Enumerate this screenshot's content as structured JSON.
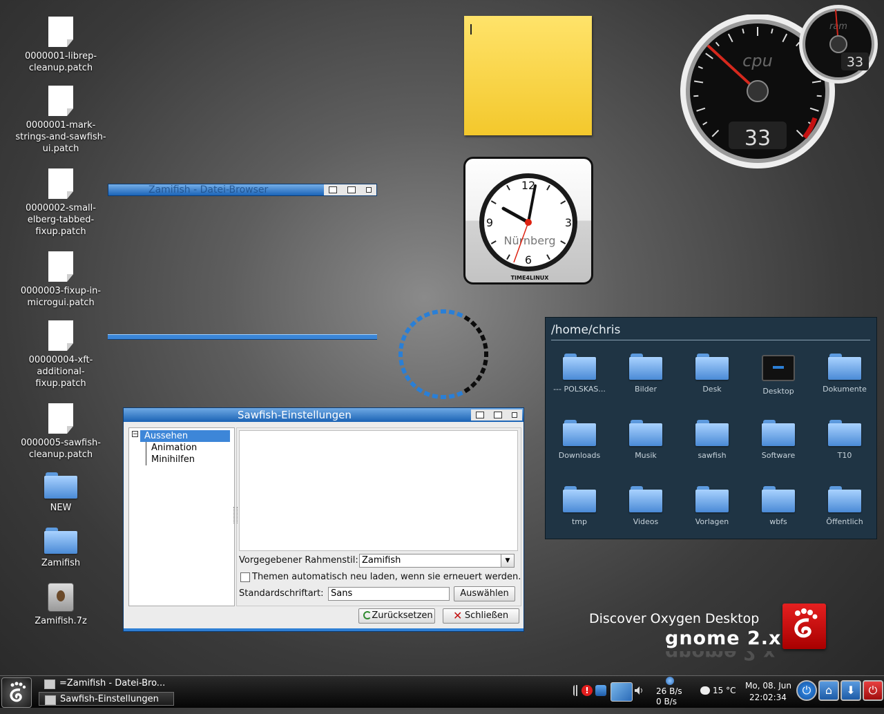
{
  "desktop": {
    "icons": [
      {
        "label": "0000001-librep-cleanup.patch",
        "type": "document"
      },
      {
        "label": "0000001-mark-strings-and-sawfish-ui.patch",
        "type": "document"
      },
      {
        "label": "0000002-small-elberg-tabbed-fixup.patch",
        "type": "document"
      },
      {
        "label": "0000003-fixup-in-microgui.patch",
        "type": "document"
      },
      {
        "label": "00000004-xft-additional-fixup.patch",
        "type": "document"
      },
      {
        "label": "0000005-sawfish-cleanup.patch",
        "type": "document"
      },
      {
        "label": "NEW",
        "type": "folder"
      },
      {
        "label": "Zamifish",
        "type": "folder"
      },
      {
        "label": "Zamifish.7z",
        "type": "archive"
      }
    ]
  },
  "file_browser_window": {
    "title": "Zamifish - Datei-Browser"
  },
  "clock": {
    "city": "Nürnberg",
    "brand": "TIME4LINUX",
    "n12": "12",
    "n3": "3",
    "n6": "6",
    "n9": "9"
  },
  "gauges": {
    "cpu": {
      "label": "cpu",
      "value": "33",
      "level_percent": 33
    },
    "ram": {
      "label": "ram",
      "value": "33",
      "level_percent": 33
    }
  },
  "folder_widget": {
    "path": "/home/chris",
    "items": [
      {
        "label": "--- POLSKAS...",
        "type": "folder"
      },
      {
        "label": "Bilder",
        "type": "folder"
      },
      {
        "label": "Desk",
        "type": "folder"
      },
      {
        "label": "Desktop",
        "type": "screen"
      },
      {
        "label": "Dokumente",
        "type": "folder"
      },
      {
        "label": "Downloads",
        "type": "folder"
      },
      {
        "label": "Musik",
        "type": "folder"
      },
      {
        "label": "sawfish",
        "type": "folder"
      },
      {
        "label": "Software",
        "type": "folder"
      },
      {
        "label": "T10",
        "type": "folder"
      },
      {
        "label": "tmp",
        "type": "folder"
      },
      {
        "label": "Videos",
        "type": "folder"
      },
      {
        "label": "Vorlagen",
        "type": "folder"
      },
      {
        "label": "wbfs",
        "type": "folder"
      },
      {
        "label": "Öffentlich",
        "type": "folder"
      }
    ]
  },
  "branding": {
    "tagline": "Discover Oxygen Desktop",
    "product": "gnome 2.x"
  },
  "settings_window": {
    "title": "Sawfish-Einstellungen",
    "tree": {
      "expander": "−",
      "items": [
        "Aussehen",
        "Animation",
        "Minihilfen"
      ]
    },
    "frame_style_label": "Vorgegebener Rahmenstil:",
    "frame_style_value": "Zamifish",
    "auto_reload_label": "Themen automatisch neu laden, wenn sie erneuert werden.",
    "auto_reload_checked": false,
    "font_label": "Standardschriftart:",
    "font_value": "Sans",
    "choose_button": "Auswählen ...",
    "reset_button": "Zurücksetzen",
    "close_button": "Schließen"
  },
  "taskbar": {
    "tasks": [
      "=Zamifish - Datei-Bro...",
      "Sawfish-Einstellungen"
    ],
    "net_down": "26 B/s",
    "net_up": "0 B/s",
    "temperature": "15 °C",
    "date": "Mo, 08. Jun",
    "time": "22:02:34"
  },
  "colors": {
    "accent": "#2f7fd4",
    "titlebar": "#1a62b4",
    "widget_bg": "#1f3444",
    "sticky": "#f6cd30",
    "gnome_red": "#d31010"
  }
}
